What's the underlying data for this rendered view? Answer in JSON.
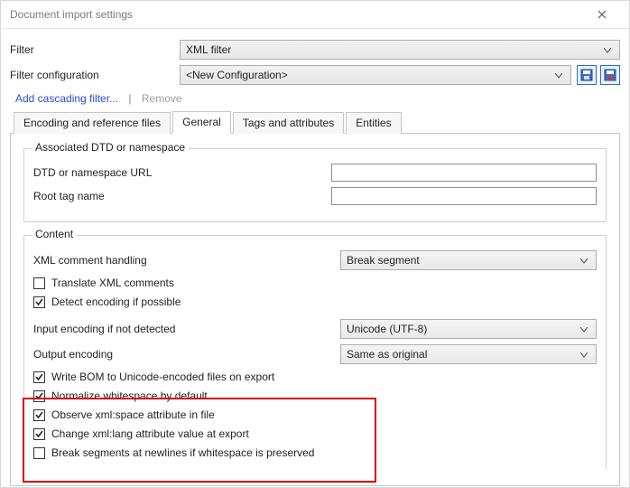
{
  "window": {
    "title": "Document import settings"
  },
  "filter": {
    "label": "Filter",
    "value": "XML filter"
  },
  "config": {
    "label": "Filter configuration",
    "value": "<New Configuration>"
  },
  "links": {
    "add": "Add cascading filter...",
    "remove": "Remove"
  },
  "tabs": {
    "encoding": "Encoding and reference files",
    "general": "General",
    "tags": "Tags and attributes",
    "entities": "Entities"
  },
  "dtd": {
    "legend": "Associated DTD or namespace",
    "url_label": "DTD or namespace URL",
    "url_value": "",
    "root_label": "Root tag name",
    "root_value": ""
  },
  "content": {
    "legend": "Content",
    "xmlcomment_label": "XML comment handling",
    "xmlcomment_value": "Break segment",
    "translate_comments": {
      "label": "Translate XML comments",
      "checked": false
    },
    "detect_encoding": {
      "label": "Detect encoding if possible",
      "checked": true
    },
    "input_enc_label": "Input encoding if not detected",
    "input_enc_value": "Unicode (UTF-8)",
    "output_enc_label": "Output encoding",
    "output_enc_value": "Same as original",
    "write_bom": {
      "label": "Write BOM to Unicode-encoded files on export",
      "checked": true
    },
    "normalize_ws": {
      "label": "Normalize whitespace by default",
      "checked": true
    },
    "observe_xmlspace": {
      "label": "Observe xml:space attribute in file",
      "checked": true
    },
    "change_xmllang": {
      "label": "Change xml:lang attribute value at export",
      "checked": true
    },
    "break_newlines": {
      "label": "Break segments at newlines if whitespace is preserved",
      "checked": false
    }
  }
}
